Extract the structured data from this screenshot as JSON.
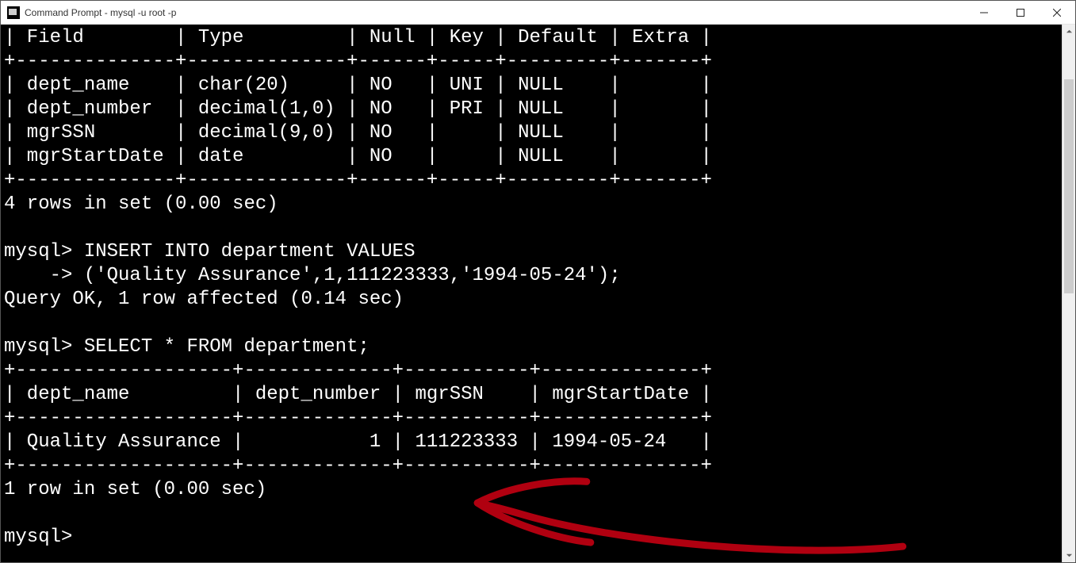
{
  "window": {
    "title": "Command Prompt - mysql  -u root -p"
  },
  "describe_table": {
    "header_row": "| Field        | Type         | Null | Key | Default | Extra |",
    "separator": "+--------------+--------------+------+-----+---------+-------+",
    "rows": [
      "| dept_name    | char(20)     | NO   | UNI | NULL    |       |",
      "| dept_number  | decimal(1,0) | NO   | PRI | NULL    |       |",
      "| mgrSSN       | decimal(9,0) | NO   |     | NULL    |       |",
      "| mgrStartDate | date         | NO   |     | NULL    |       |"
    ],
    "footer": "4 rows in set (0.00 sec)"
  },
  "insert_block": {
    "line1": "mysql> INSERT INTO department VALUES",
    "line2": "    -> ('Quality Assurance',1,111223333,'1994-05-24');",
    "result": "Query OK, 1 row affected (0.14 sec)"
  },
  "select_block": {
    "query": "mysql> SELECT * FROM department;",
    "separator": "+-------------------+-------------+-----------+--------------+",
    "header": "| dept_name         | dept_number | mgrSSN    | mgrStartDate |",
    "row1": "| Quality Assurance |           1 | 111223333 | 1994-05-24   |",
    "footer": "1 row in set (0.00 sec)"
  },
  "prompt": "mysql>",
  "scrollbar": {
    "thumb_top_percent": 8,
    "thumb_height_percent": 42
  },
  "annotation": {
    "color": "#b00010"
  }
}
